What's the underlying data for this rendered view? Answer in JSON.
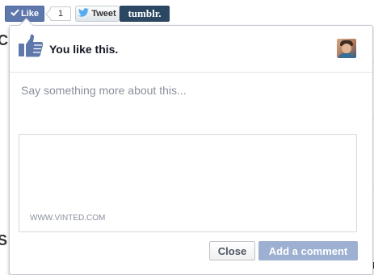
{
  "share_bar": {
    "like_label": "Like",
    "like_count": "1",
    "tweet_label": "Tweet",
    "tumblr_label": "tumblr."
  },
  "popup": {
    "header_text": "You like this.",
    "comment_placeholder": "Say something more about this...",
    "preview_domain": "WWW.VINTED.COM",
    "close_label": "Close",
    "add_comment_label": "Add a comment"
  },
  "background": {
    "letter_top": "C",
    "letter_bottom": "S"
  },
  "colors": {
    "facebook_blue": "#5f78ab",
    "tumblr_navy": "#2c4762",
    "twitter_blue": "#55acee",
    "disabled_button": "#9db0d2"
  },
  "icons": [
    "checkmark-icon",
    "twitter-bird-icon",
    "thumbs-up-icon"
  ]
}
